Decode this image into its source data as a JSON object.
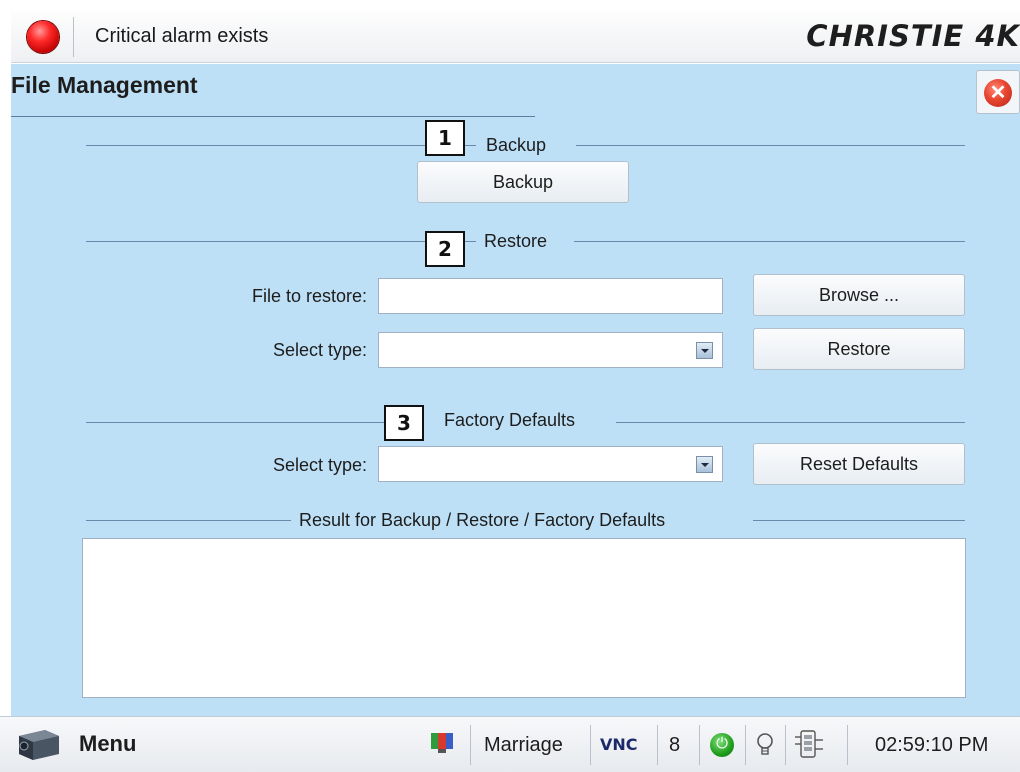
{
  "header": {
    "alarm_text": "Critical alarm exists",
    "brand": "CHRISTIE 4K",
    "alarm_color": "#e01010"
  },
  "page": {
    "title": "File Management",
    "close_icon": "close-icon"
  },
  "backup": {
    "section_label": "Backup",
    "badge": "1",
    "button_label": "Backup"
  },
  "restore": {
    "section_label": "Restore",
    "badge": "2",
    "file_label": "File to restore:",
    "file_value": "",
    "browse_label": "Browse ...",
    "type_label": "Select type:",
    "type_value": "",
    "restore_label": "Restore"
  },
  "factory": {
    "section_label": "Factory Defaults",
    "badge": "3",
    "type_label": "Select type:",
    "type_value": "",
    "reset_label": "Reset Defaults"
  },
  "result": {
    "section_label": "Result for Backup / Restore / Factory Defaults",
    "text": ""
  },
  "taskbar": {
    "menu_label": "Menu",
    "mode": "Marriage",
    "vnc": "VNC",
    "count": "8",
    "time": "02:59:10 PM",
    "icons": [
      "projector-icon",
      "test-pattern-icon",
      "power-icon",
      "lamp-icon",
      "network-icon"
    ]
  },
  "colors": {
    "panel_bg": "#bde0f6",
    "accent_line": "#6a8aac"
  }
}
